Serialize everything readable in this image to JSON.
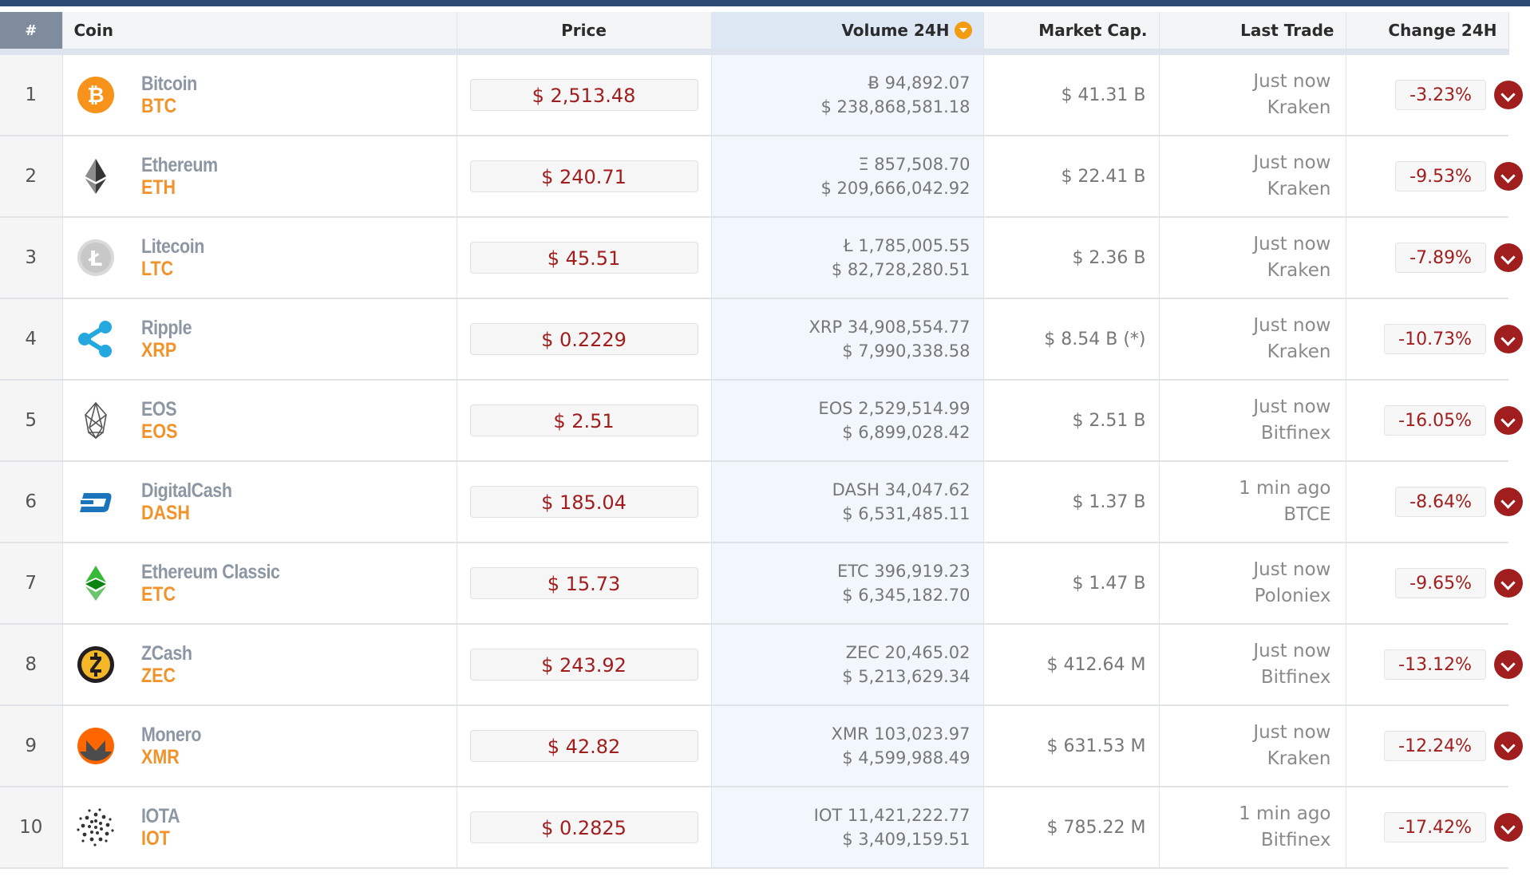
{
  "header": {
    "rank": "#",
    "coin": "Coin",
    "price": "Price",
    "volume": "Volume 24H",
    "market_cap": "Market Cap.",
    "last_trade": "Last Trade",
    "change": "Change 24H",
    "sort_icon": "sort-desc-icon"
  },
  "colors": {
    "price_text": "#a11e1e",
    "coin_name": "#8c97a3",
    "coin_symbol": "#f0932b",
    "sorted_column_bg": "#f2f7fd",
    "sort_icon": "#f39c12",
    "header_rank_bg": "#7e8c9e"
  },
  "rows": [
    {
      "rank": "1",
      "name": "Bitcoin",
      "symbol": "BTC",
      "icon": "bitcoin-icon",
      "price": "$ 2,513.48",
      "vol_coin": "Ƀ 94,892.07",
      "vol_usd": "$ 238,868,581.18",
      "cap": "$ 41.31 B",
      "time": "Just now",
      "exchange": "Kraken",
      "change": "-3.23%"
    },
    {
      "rank": "2",
      "name": "Ethereum",
      "symbol": "ETH",
      "icon": "ethereum-icon",
      "price": "$ 240.71",
      "vol_coin": "Ξ 857,508.70",
      "vol_usd": "$ 209,666,042.92",
      "cap": "$ 22.41 B",
      "time": "Just now",
      "exchange": "Kraken",
      "change": "-9.53%"
    },
    {
      "rank": "3",
      "name": "Litecoin",
      "symbol": "LTC",
      "icon": "litecoin-icon",
      "price": "$ 45.51",
      "vol_coin": "Ł 1,785,005.55",
      "vol_usd": "$ 82,728,280.51",
      "cap": "$ 2.36 B",
      "time": "Just now",
      "exchange": "Kraken",
      "change": "-7.89%"
    },
    {
      "rank": "4",
      "name": "Ripple",
      "symbol": "XRP",
      "icon": "ripple-icon",
      "price": "$ 0.2229",
      "vol_coin": "XRP 34,908,554.77",
      "vol_usd": "$ 7,990,338.58",
      "cap": "$ 8.54 B (*)",
      "time": "Just now",
      "exchange": "Kraken",
      "change": "-10.73%"
    },
    {
      "rank": "5",
      "name": "EOS",
      "symbol": "EOS",
      "icon": "eos-icon",
      "price": "$ 2.51",
      "vol_coin": "EOS 2,529,514.99",
      "vol_usd": "$ 6,899,028.42",
      "cap": "$ 2.51 B",
      "time": "Just now",
      "exchange": "Bitfinex",
      "change": "-16.05%"
    },
    {
      "rank": "6",
      "name": "DigitalCash",
      "symbol": "DASH",
      "icon": "dash-icon",
      "price": "$ 185.04",
      "vol_coin": "DASH 34,047.62",
      "vol_usd": "$ 6,531,485.11",
      "cap": "$ 1.37 B",
      "time": "1 min ago",
      "exchange": "BTCE",
      "change": "-8.64%"
    },
    {
      "rank": "7",
      "name": "Ethereum Classic",
      "symbol": "ETC",
      "icon": "ethereum-classic-icon",
      "price": "$ 15.73",
      "vol_coin": "ETC 396,919.23",
      "vol_usd": "$ 6,345,182.70",
      "cap": "$ 1.47 B",
      "time": "Just now",
      "exchange": "Poloniex",
      "change": "-9.65%"
    },
    {
      "rank": "8",
      "name": "ZCash",
      "symbol": "ZEC",
      "icon": "zcash-icon",
      "price": "$ 243.92",
      "vol_coin": "ZEC 20,465.02",
      "vol_usd": "$ 5,213,629.34",
      "cap": "$ 412.64 M",
      "time": "Just now",
      "exchange": "Bitfinex",
      "change": "-13.12%"
    },
    {
      "rank": "9",
      "name": "Monero",
      "symbol": "XMR",
      "icon": "monero-icon",
      "price": "$ 42.82",
      "vol_coin": "XMR 103,023.97",
      "vol_usd": "$ 4,599,988.49",
      "cap": "$ 631.53 M",
      "time": "Just now",
      "exchange": "Kraken",
      "change": "-12.24%"
    },
    {
      "rank": "10",
      "name": "IOTA",
      "symbol": "IOT",
      "icon": "iota-icon",
      "price": "$ 0.2825",
      "vol_coin": "IOT 11,421,222.77",
      "vol_usd": "$ 3,409,159.51",
      "cap": "$ 785.22 M",
      "time": "1 min ago",
      "exchange": "Bitfinex",
      "change": "-17.42%"
    }
  ]
}
